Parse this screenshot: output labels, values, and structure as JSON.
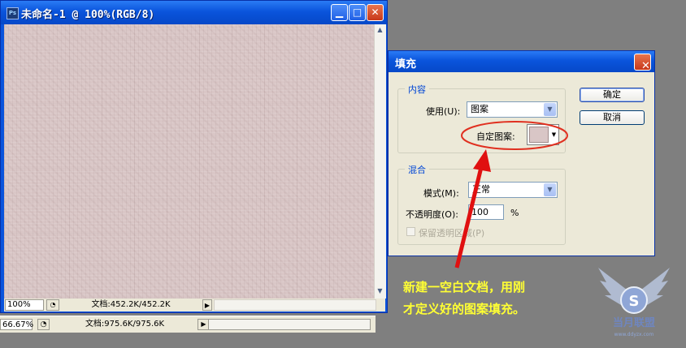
{
  "back_window": {
    "zoom": "66.67%",
    "doc_size": "文档:975.6K/975.6K"
  },
  "doc_window": {
    "title": "未命名-1 @ 100%(RGB/8)",
    "app_icon_text": "Ps",
    "zoom": "100%",
    "doc_size": "文档:452.2K/452.2K"
  },
  "fill_dialog": {
    "title": "填充",
    "contents_group": {
      "legend": "内容",
      "use_label": "使用(U):",
      "use_value": "图案",
      "custom_pattern_label": "自定图案:"
    },
    "blending_group": {
      "legend": "混合",
      "mode_label": "模式(M):",
      "mode_value": "正常",
      "opacity_label": "不透明度(O):",
      "opacity_value": "100",
      "opacity_unit": "%",
      "preserve_transparency_label": "保留透明区域(P)"
    },
    "ok_label": "确定",
    "cancel_label": "取消"
  },
  "annotation": {
    "line1": "新建一空白文档，用刚",
    "line2": "才定义好的图案填充。"
  },
  "watermark": {
    "text": "当月联盟",
    "url": "www.ddyzx.com"
  },
  "colors": {
    "annotation_text": "#ffff33",
    "arrow": "#e01010",
    "highlight_ellipse": "#e03020",
    "xp_title_blue": "#0a54dc",
    "pattern_swatch": "#d9c6c6"
  },
  "icons": {
    "close": "close-icon",
    "minimize": "minimize-icon",
    "maximize": "maximize-icon",
    "dropdown": "chevron-down-icon"
  }
}
